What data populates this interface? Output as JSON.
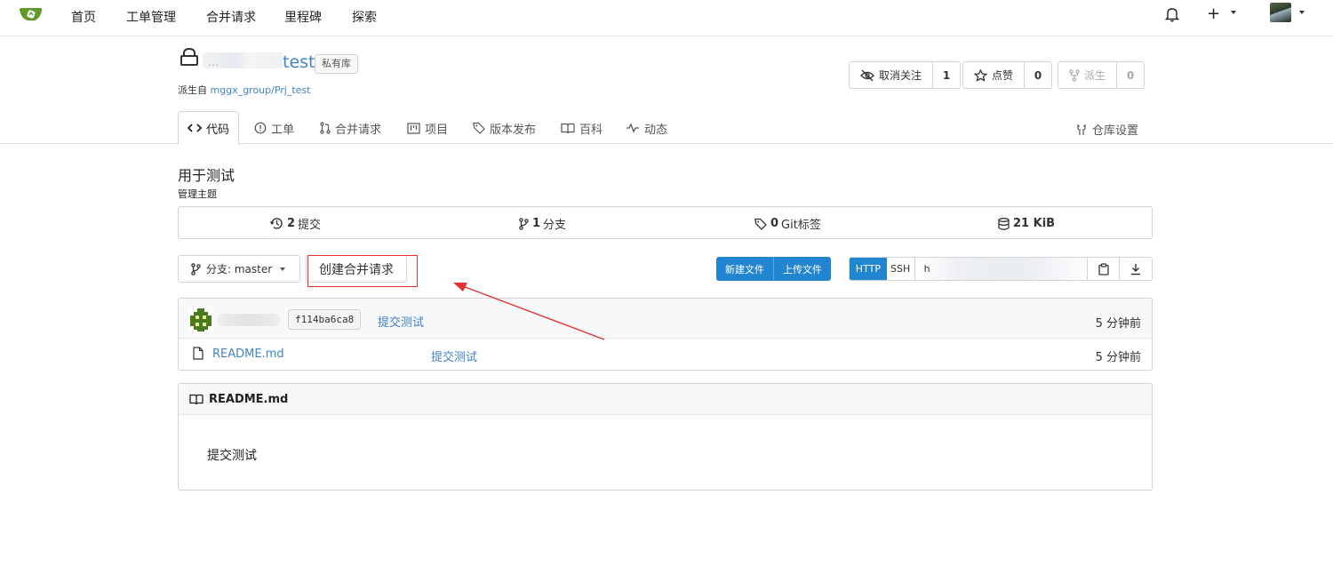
{
  "nav": {
    "items": [
      "首页",
      "工单管理",
      "合并请求",
      "里程碑",
      "探索"
    ],
    "plus": "+"
  },
  "repo": {
    "name": "test",
    "private_label": "私有库",
    "forked_from_prefix": "派生自",
    "forked_from": "mggx_group/Prj_test"
  },
  "actions": {
    "unwatch": {
      "label": "取消关注",
      "count": "1"
    },
    "star": {
      "label": "点赞",
      "count": "0"
    },
    "fork": {
      "label": "派生",
      "count": "0"
    }
  },
  "tabs": [
    "代码",
    "工单",
    "合并请求",
    "项目",
    "版本发布",
    "百科",
    "动态"
  ],
  "settings_tab": "仓库设置",
  "description": "用于测试",
  "topics_label": "管理主题",
  "stats": {
    "commits": {
      "count": "2",
      "label": "提交"
    },
    "branches": {
      "count": "1",
      "label": "分支"
    },
    "tags": {
      "count": "0",
      "label": "Git标签"
    },
    "size": {
      "count": "21 KiB"
    }
  },
  "branch": {
    "label": "分支: master"
  },
  "create_mr": "创建合并请求",
  "file_buttons": {
    "new_file": "新建文件",
    "upload": "上传文件"
  },
  "clone": {
    "http": "HTTP",
    "ssh": "SSH",
    "url": "h"
  },
  "latest_commit": {
    "sha": "f114ba6ca8",
    "message": "提交测试",
    "time": "5 分钟前"
  },
  "files": [
    {
      "name": "README.md",
      "message": "提交测试",
      "time": "5 分钟前"
    }
  ],
  "readme": {
    "title": "README.md",
    "content": "提交测试"
  },
  "colors": {
    "link": "#4183c4",
    "primary": "#2185d0",
    "annotation": "#e33333",
    "logo": "#609926"
  }
}
